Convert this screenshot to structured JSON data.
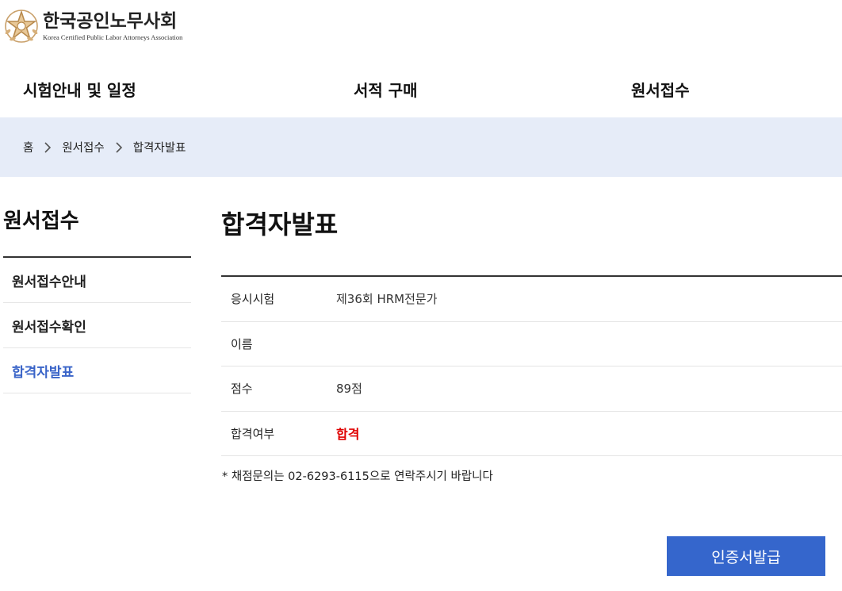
{
  "header": {
    "logo_kr": "한국공인노무사회",
    "logo_en": "Korea Certified Public Labor Attorneys Association",
    "emblem_color": "#c9a06a"
  },
  "gnb": [
    {
      "label": "시험안내 및 일정"
    },
    {
      "label": "서적 구매"
    },
    {
      "label": "원서접수"
    }
  ],
  "breadcrumb": {
    "home": "홈",
    "level1": "원서접수",
    "level2": "합격자발표"
  },
  "sidebar": {
    "title": "원서접수",
    "items": [
      {
        "label": "원서접수안내"
      },
      {
        "label": "원서접수확인"
      },
      {
        "label": "합격자발표"
      }
    ],
    "active_color": "#3a64c8"
  },
  "content": {
    "title": "합격자발표",
    "rows": [
      {
        "label": "응시시험",
        "value": "제36회 HRM전문가"
      },
      {
        "label": "이름",
        "value": ""
      },
      {
        "label": "점수",
        "value": "89점"
      },
      {
        "label": "합격여부",
        "value": "합격"
      }
    ],
    "pass_color": "#e00000",
    "note": "* 채점문의는 02-6293-6115으로 연락주시기 바랍니다",
    "cert_button": "인증서발급",
    "button_color": "#3566cc"
  },
  "colors": {
    "breadcrumb_bg": "#e6ecf8"
  }
}
